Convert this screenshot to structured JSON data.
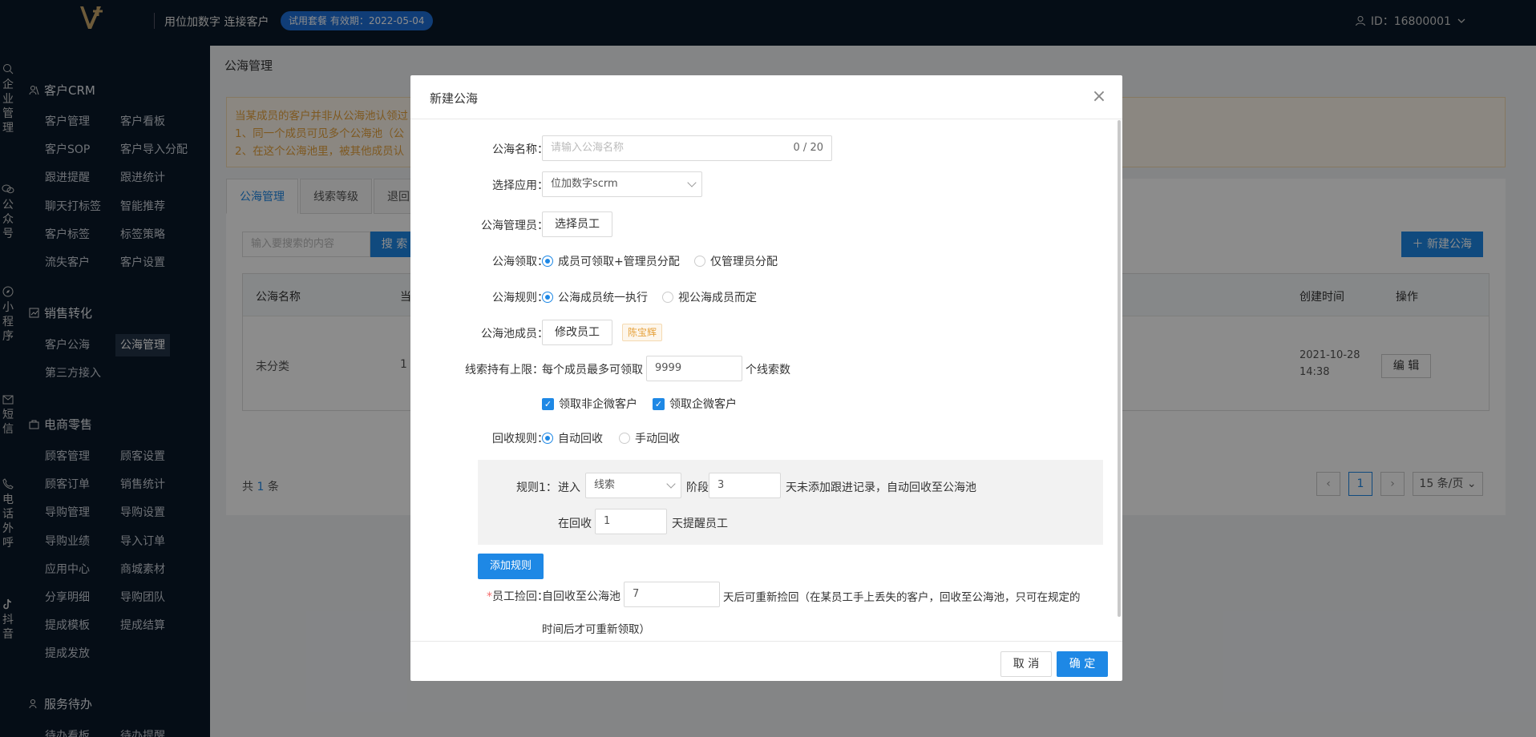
{
  "header": {
    "slogan": "用位加数字 连接客户",
    "trial_badge": "试用套餐 有效期：2022-05-04",
    "user_id": "ID：16800001"
  },
  "icon_rail": [
    {
      "icon": "search-icon",
      "label": "企业管理"
    },
    {
      "icon": "wechat-icon",
      "label": "公众号"
    },
    {
      "icon": "compass-icon",
      "label": "小程序"
    },
    {
      "icon": "mail-icon",
      "label": "短信"
    },
    {
      "icon": "phone-icon",
      "label": "电话外呼"
    },
    {
      "icon": "tiktok-icon",
      "label": "抖音"
    }
  ],
  "sidebar": {
    "crm": {
      "title": "客户CRM",
      "items": [
        "客户管理",
        "客户看板",
        "客户SOP",
        "客户导入分配",
        "跟进提醒",
        "跟进统计",
        "聊天打标签",
        "智能推荐",
        "客户标签",
        "标签策略",
        "流失客户",
        "客户设置"
      ]
    },
    "sales": {
      "title": "销售转化",
      "items": [
        "客户公海",
        "公海管理",
        "第三方接入"
      ]
    },
    "ecom": {
      "title": "电商零售",
      "items": [
        "顾客管理",
        "顾客设置",
        "顾客订单",
        "销售统计",
        "导购管理",
        "导购设置",
        "导购业绩",
        "导入订单",
        "应用中心",
        "商城素材",
        "分享明细",
        "导购团队",
        "提成模板",
        "提成结算",
        "提成发放"
      ]
    },
    "service": {
      "title": "服务待办",
      "items": [
        "待办看板",
        "待办提醒"
      ]
    }
  },
  "main": {
    "breadcrumb": "公海管理",
    "notice": [
      "当某成员的客户并非从公海池认领过",
      "1、同一个成员可见多个公海池（公",
      "2、在这个公海池里，被其他成员认"
    ],
    "tabs": [
      "公海管理",
      "线索等级",
      "退回"
    ],
    "search_placeholder": "输入要搜索的内容",
    "search_button": "搜 索",
    "new_button": "新建公海",
    "table": {
      "headers": [
        "公海名称",
        "当",
        "创建时间",
        "操作"
      ],
      "rows": [
        {
          "name": "未分类",
          "count": "1",
          "created_date": "2021-10-28",
          "created_time": "14:38",
          "action": "编 辑"
        }
      ]
    },
    "total_prefix": "共",
    "total_count": "1",
    "total_suffix": "条",
    "pagination": {
      "current": "1",
      "page_size": "15 条/页"
    }
  },
  "modal": {
    "title": "新建公海",
    "name_label": "公海名称：",
    "name_placeholder": "请输入公海名称",
    "name_counter": "0 / 20",
    "app_label": "选择应用：",
    "app_value": "位加数字scrm",
    "admin_label": "公海管理员：",
    "admin_button": "选择员工",
    "claim_label": "公海领取：",
    "claim_options": [
      "成员可领取+管理员分配",
      "仅管理员分配"
    ],
    "rule_label": "公海规则：",
    "rule_options": [
      "公海成员统一执行",
      "视公海成员而定"
    ],
    "members_label": "公海池成员：",
    "members_button": "修改员工",
    "member_tag": "陈宝辉",
    "limit_label": "线索持有上限：",
    "limit_prefix": "每个成员最多可领取",
    "limit_value": "9999",
    "limit_suffix": "个线索数",
    "checkbox_non_wecom": "领取非企微客户",
    "checkbox_wecom": "领取企微客户",
    "recycle_label": "回收规则：",
    "recycle_options": [
      "自动回收",
      "手动回收"
    ],
    "rule1": {
      "label": "规则1：",
      "enter": "进入",
      "stage_select": "线索",
      "stage_text": "阶段",
      "days_value": "3",
      "days_suffix": "天未添加跟进记录，自动回收至公海池",
      "remind_prefix": "在回收",
      "remind_value": "1",
      "remind_suffix": "天提醒员工"
    },
    "add_rule_button": "添加规则",
    "pickback_required": "*",
    "pickback_label": "员工捡回：",
    "pickback_prefix": "自回收至公海池",
    "pickback_value": "7",
    "pickback_suffix": "天后可重新捡回（在某员工手上丢失的客户，回收至公海池，只可在规定的",
    "pickback_suffix2": "时间后才可重新领取）",
    "cancel_button": "取 消",
    "ok_button": "确 定"
  }
}
